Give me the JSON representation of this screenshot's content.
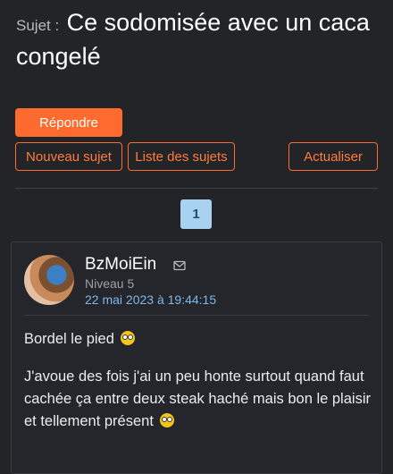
{
  "topic": {
    "subject_label": "Sujet :",
    "title": "Ce sodomisée avec un caca congelé"
  },
  "actions": {
    "reply": "Répondre",
    "new_topic": "Nouveau sujet",
    "topic_list": "Liste des sujets",
    "refresh": "Actualiser"
  },
  "pagination": {
    "current_page": "1"
  },
  "post": {
    "author": "BzMoiEin",
    "level": "Niveau 5",
    "date": "22 mai 2023 à 19:44:15",
    "paragraphs": [
      "Bordel le pied",
      "J'avoue des fois j'ai un peu honte surtout quand faut cachée ça entre deux steak haché mais bon le plaisir et tellement présent"
    ],
    "emoji": "flushed-face-emoji"
  },
  "icons": [
    "mail-icon",
    "flushed-face-emoji"
  ],
  "colors": {
    "accent": "#ff6a2e",
    "background": "#232428",
    "date": "#7fb6e8",
    "page_active": "#a8d2f0"
  }
}
